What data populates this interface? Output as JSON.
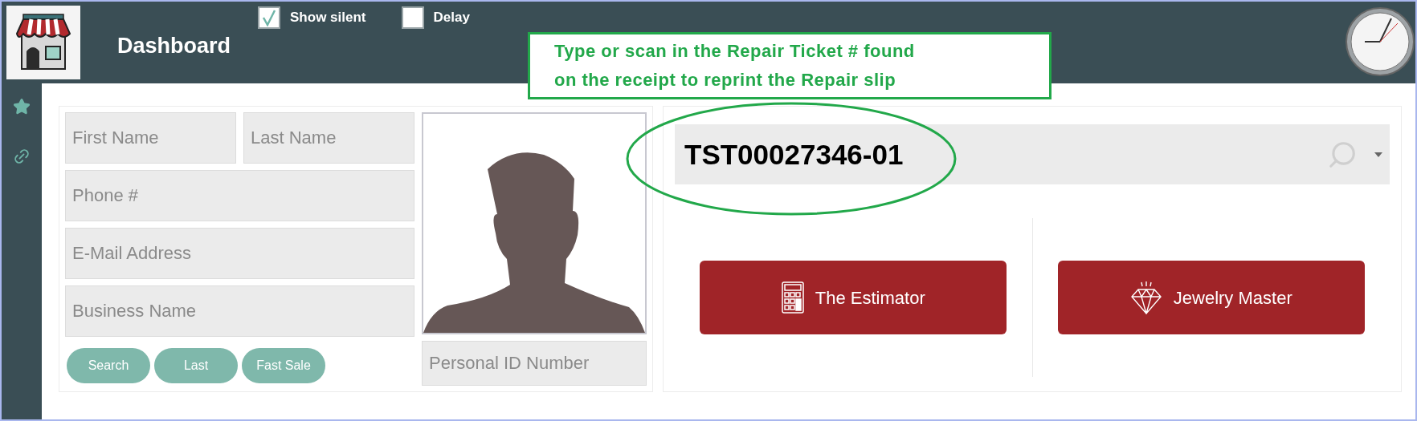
{
  "header": {
    "title": "Dashboard",
    "options": [
      {
        "label": "Show silent",
        "checked": true
      },
      {
        "label": "Delay",
        "checked": false
      }
    ]
  },
  "callout": {
    "text": "Type or scan in the Repair Ticket # found\non the receipt to reprint the Repair slip"
  },
  "customer_form": {
    "name_fields": [
      {
        "placeholder": "First Name"
      },
      {
        "placeholder": "Last Name"
      }
    ],
    "fields": [
      {
        "placeholder": "Phone #"
      },
      {
        "placeholder": "E-Mail Address"
      },
      {
        "placeholder": "Business Name"
      }
    ],
    "buttons": [
      "Search",
      "Last",
      "Fast Sale"
    ],
    "id_field": {
      "placeholder": "Personal ID Number"
    }
  },
  "ticket_search": {
    "value": "TST00027346-01"
  },
  "apps": [
    {
      "kind": "calculator",
      "label": "The Estimator"
    },
    {
      "kind": "gem",
      "label": "Jewelry Master"
    }
  ]
}
